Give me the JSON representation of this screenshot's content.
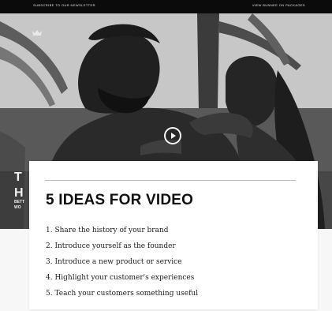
{
  "topbar": {
    "left_text": "SUBSCRIBE TO OUR NEWSLETTER",
    "right_text": "VIEW BUNNEE ON PACKAGES"
  },
  "hero": {
    "title_peek": "T\nH",
    "subtitle_peek": "BETT\nWO",
    "icons": [
      "crown-logo-icon",
      "play-icon"
    ]
  },
  "card": {
    "title": "5 IDEAS FOR VIDEO",
    "items": [
      "1. Share the history of your brand",
      "2. Introduce yourself as the founder",
      "3. Introduce a new product or service",
      "4. Highlight your customer's experiences",
      "5. Teach your customers something useful"
    ]
  }
}
